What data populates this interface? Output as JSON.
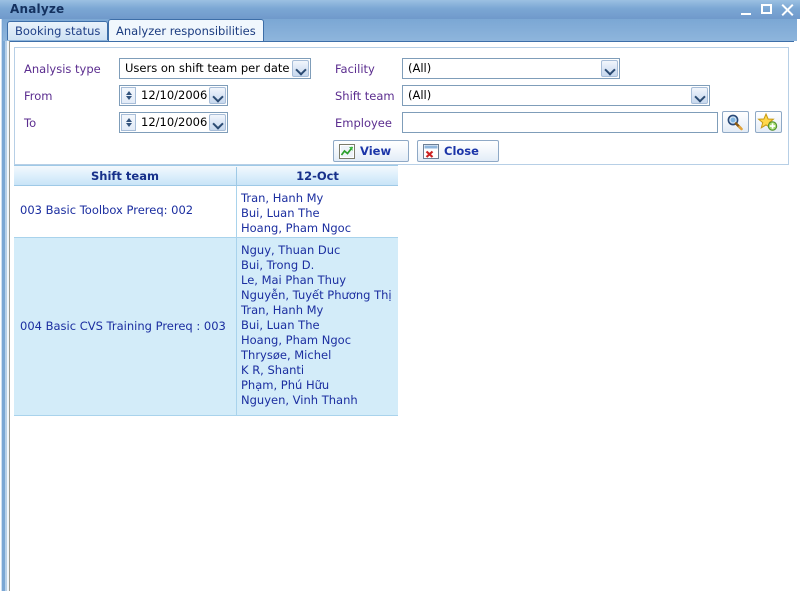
{
  "window": {
    "title": "Analyze",
    "controls": {
      "minimize": "minimize-button",
      "maximize": "maximize-button",
      "close": "close-button"
    }
  },
  "tabs": [
    {
      "label": "Booking status",
      "active": false
    },
    {
      "label": "Analyzer responsibilities",
      "active": true
    }
  ],
  "form": {
    "analysis_type": {
      "label": "Analysis type",
      "value": "Users on shift team per date"
    },
    "from": {
      "label": "From",
      "value": "12/10/2006"
    },
    "to": {
      "label": "To",
      "value": "12/10/2006"
    },
    "facility": {
      "label": "Facility",
      "value": "(All)"
    },
    "shift_team": {
      "label": "Shift team",
      "value": "(All)"
    },
    "employee": {
      "label": "Employee",
      "value": "",
      "placeholder": ""
    },
    "employee_search_icon": "search-magnifier-icon",
    "employee_favorite_icon": "star-add-icon",
    "view_button": {
      "label": "View",
      "icon": "chart-icon"
    },
    "close_button": {
      "label": "Close",
      "icon": "close-window-icon"
    }
  },
  "grid": {
    "columns": [
      "Shift team",
      "12-Oct"
    ],
    "rows": [
      {
        "team": "003 Basic Toolbox Prereq: 002",
        "names": [
          "Tran, Hanh My",
          "Bui, Luan The",
          "Hoang, Pham Ngoc"
        ]
      },
      {
        "team": "004 Basic CVS Training Prereq : 003",
        "names": [
          "Nguy, Thuan Duc",
          "Bui, Trong D.",
          "Le, Mai Phan Thuy",
          "Nguyễn, Tuyết Phương Thị",
          "Tran, Hanh My",
          "Bui, Luan The",
          "Hoang, Pham Ngoc",
          "Thrysøe, Michel",
          "K R, Shanti",
          "Phạm, Phú Hữu",
          "Nguyen, Vinh Thanh"
        ]
      }
    ]
  },
  "colors": {
    "titlebar": "#7ba7d4",
    "tab_active_bg": "#f0f7fd",
    "grid_header_bg": "#d6ecf9",
    "row_alt_bg": "#d3ecf9",
    "text_blue": "#1b2ea0",
    "label_purple": "#5b2d8f"
  }
}
